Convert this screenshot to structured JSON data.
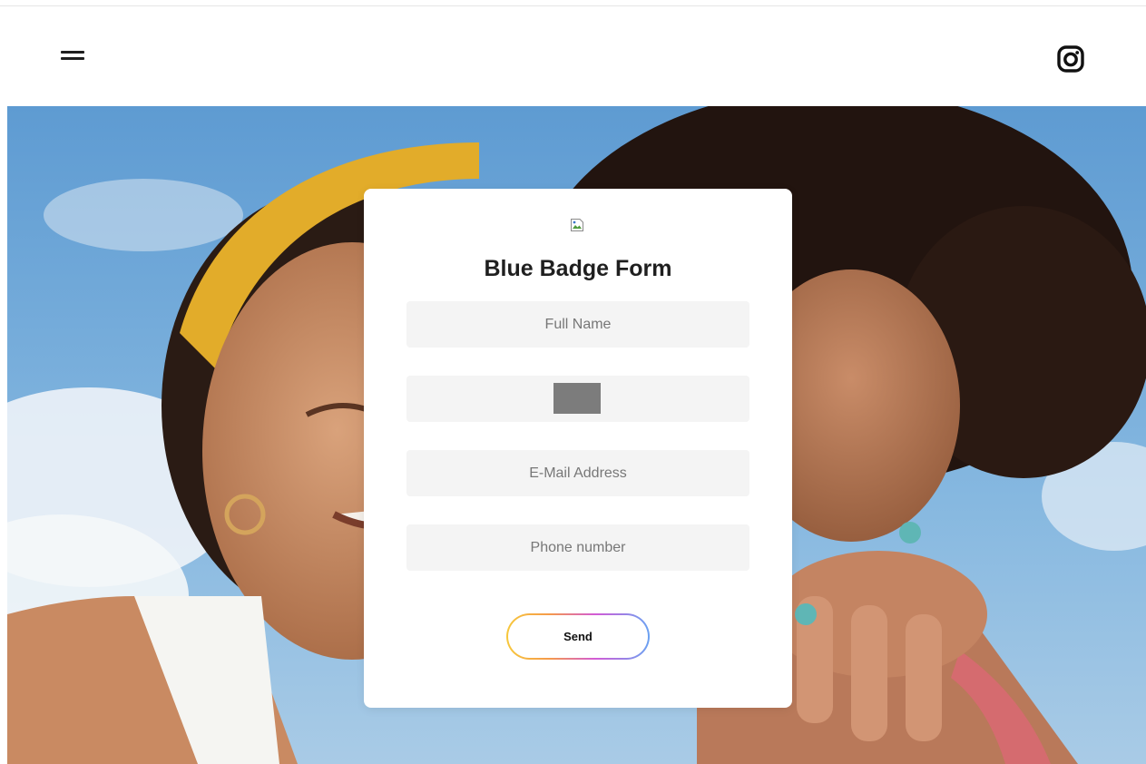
{
  "header": {
    "menu_icon": "hamburger-menu-icon",
    "social_icon": "instagram-icon"
  },
  "hero": {
    "image": "photo of two smiling women outdoors against a blue sky"
  },
  "form": {
    "logo_icon": "broken-image-icon",
    "title": "Blue Badge Form",
    "full_name_placeholder": "Full Name",
    "email_placeholder": "E-Mail Address",
    "phone_placeholder": "Phone number",
    "send_label": "Send"
  },
  "colors": {
    "field_background": "#f4f4f4",
    "button_gradient": [
      "#f7c83b",
      "#f59a4a",
      "#d35bd6",
      "#6aa2f2"
    ],
    "sky": "#6fa6d6"
  }
}
